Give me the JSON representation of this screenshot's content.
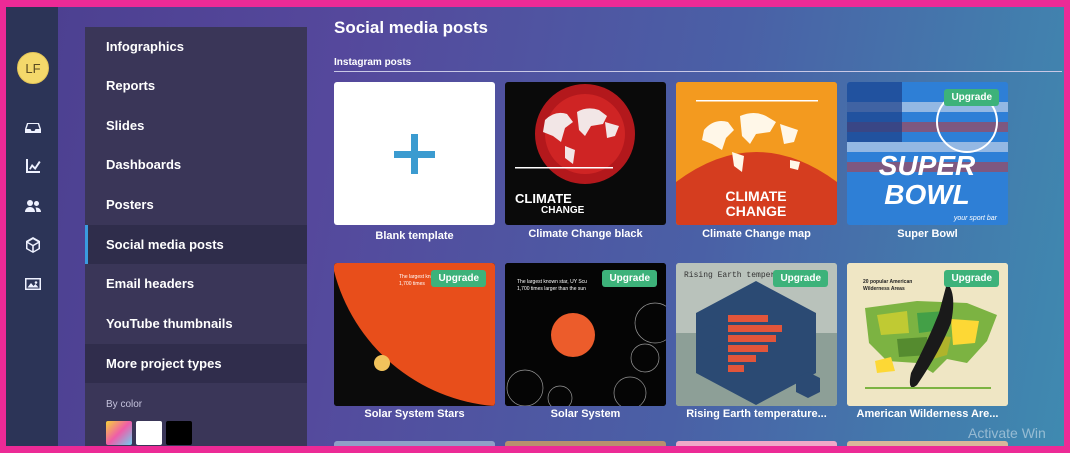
{
  "user": {
    "initials": "LF"
  },
  "rail": {
    "icons": [
      "inbox-icon",
      "chart-icon",
      "team-icon",
      "cube-icon",
      "image-icon"
    ]
  },
  "categories": [
    {
      "label": "Infographics"
    },
    {
      "label": "Reports"
    },
    {
      "label": "Slides"
    },
    {
      "label": "Dashboards"
    },
    {
      "label": "Posters"
    },
    {
      "label": "Social media posts",
      "active": true
    },
    {
      "label": "Email headers"
    },
    {
      "label": "YouTube thumbnails"
    },
    {
      "label": "More project types"
    }
  ],
  "filter": {
    "by_color_label": "By color",
    "swatches": [
      "#f0b23c",
      "#ffffff",
      "#000000"
    ]
  },
  "main": {
    "title": "Social media posts",
    "section": "Instagram posts",
    "upgrade_label": "Upgrade",
    "templates": [
      {
        "label": "Blank template",
        "upgrade": false
      },
      {
        "label": "Climate Change black",
        "upgrade": false,
        "art_text": [
          "CLIMATE",
          "CHANGE"
        ]
      },
      {
        "label": "Climate Change map",
        "upgrade": false,
        "art_text": [
          "CLIMATE",
          "CHANGE"
        ]
      },
      {
        "label": "Super Bowl",
        "upgrade": true,
        "art_text": [
          "SUPER",
          "BOWL",
          "your sport bar"
        ]
      },
      {
        "label": "Solar System Stars",
        "upgrade": true,
        "art_text": [
          "The largest kn",
          "1,700 times"
        ]
      },
      {
        "label": "Solar System",
        "upgrade": true,
        "art_text": [
          "The largest known star, UY Scu",
          "1,700 times larger than the sun"
        ]
      },
      {
        "label": "Rising Earth temperature...",
        "upgrade": true,
        "art_text": [
          "Rising Earth temperatures"
        ]
      },
      {
        "label": "American Wilderness Are...",
        "upgrade": true,
        "art_text": [
          "20 popular American",
          "Wilderness Areas"
        ]
      }
    ]
  },
  "watermark": "Activate Win"
}
